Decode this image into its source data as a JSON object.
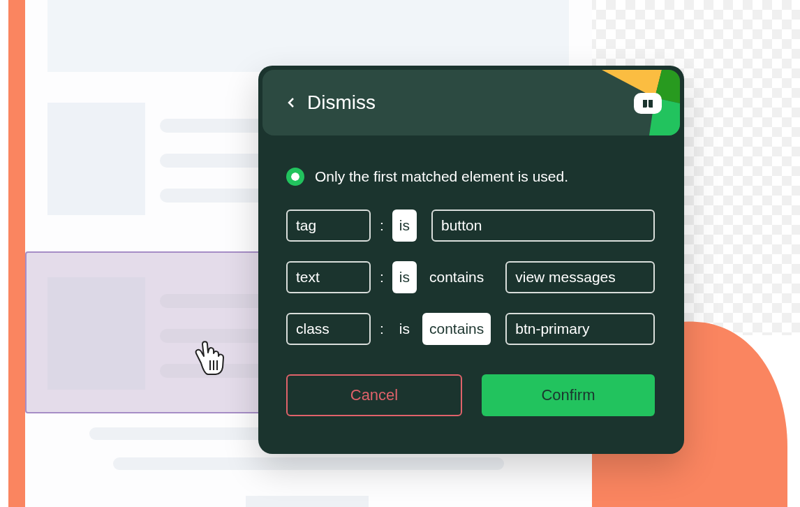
{
  "dialog": {
    "title": "Dismiss",
    "notice": {
      "text": "Only the first matched element is used.",
      "selected": true
    },
    "conditions": [
      {
        "attribute": "tag",
        "separator": ":",
        "operators": [
          {
            "label": "is",
            "selected": true
          }
        ],
        "value": "button"
      },
      {
        "attribute": "text",
        "separator": ":",
        "operators": [
          {
            "label": "is",
            "selected": true
          },
          {
            "label": "contains",
            "selected": false
          }
        ],
        "value": "view messages"
      },
      {
        "attribute": "class",
        "separator": ":",
        "operators": [
          {
            "label": "is",
            "selected": false
          },
          {
            "label": "contains",
            "selected": true
          }
        ],
        "value": "btn-primary"
      }
    ],
    "buttons": [
      {
        "label": "Cancel",
        "kind": "secondary"
      },
      {
        "label": "Confirm",
        "kind": "primary"
      }
    ]
  }
}
